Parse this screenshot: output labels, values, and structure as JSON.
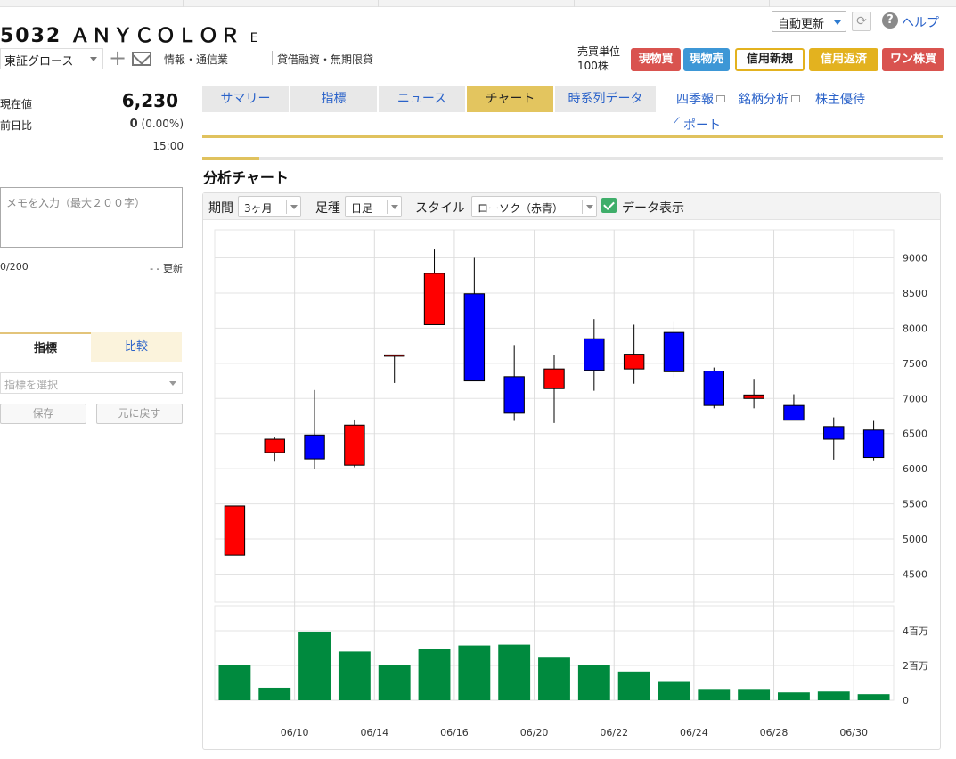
{
  "header": {
    "ticker_name": "5032 ＡＮＹＣＯＬＯＲ",
    "ticker_suffix": "E",
    "market": "東証グロース",
    "industry": "情報・通信業",
    "margin_type": "貸借融資・無期限貸",
    "auto_update": "自動更新",
    "help": "ヘルプ"
  },
  "trade": {
    "unit_label": "売買単位",
    "unit_value": "100株",
    "buttons": [
      "現物買",
      "現物売",
      "信用新規",
      "信用返済",
      "ワン株買"
    ]
  },
  "quote": {
    "price_label": "現在値",
    "price": "6,230",
    "change_label": "前日比",
    "change": "0",
    "change_pct": "(0.00%)",
    "time": "15:00"
  },
  "memo": {
    "placeholder": "メモを入力（最大２００字）",
    "count": "0/200",
    "updated": "- - 更新"
  },
  "indicator_panel": {
    "tabs": [
      "指標",
      "比較"
    ],
    "select_placeholder": "指標を選択",
    "save_label": "保存",
    "reset_label": "元に戻す"
  },
  "nav": {
    "tabs": [
      "サマリー",
      "指標",
      "ニュース",
      "チャート",
      "時系列データ"
    ],
    "active_tab": "チャート",
    "links": [
      "四季報",
      "銘柄分析",
      "株主優待"
    ],
    "report_link": "レポート"
  },
  "chart_panel": {
    "title": "分析チャート",
    "period_label": "期間",
    "period_value": "3ヶ月",
    "interval_label": "足種",
    "interval_value": "日足",
    "style_label": "スタイル",
    "style_value": "ローソク（赤青）",
    "data_display_label": "データ表示",
    "data_display_checked": true
  },
  "chart_data": {
    "type": "candlestick",
    "up_color": "#ff0000",
    "down_color": "#0000ff",
    "volume_color": "#008a3e",
    "price_axis": {
      "ticks": [
        4500,
        5000,
        5500,
        6000,
        6500,
        7000,
        7500,
        8000,
        8500,
        9000
      ],
      "range": [
        4100,
        9400
      ]
    },
    "volume_axis": {
      "tick_labels": [
        "0",
        "2百万",
        "4百万"
      ],
      "tick_values": [
        0,
        2000000,
        4000000
      ],
      "max": 4000000
    },
    "x_labels": [
      "06/10",
      "06/14",
      "06/16",
      "06/20",
      "06/22",
      "06/24",
      "06/28",
      "06/30"
    ],
    "x_label_days": [
      2,
      4,
      6,
      8,
      10,
      12,
      14,
      16
    ],
    "candles": [
      {
        "day": 1,
        "open": 4770,
        "high": 5470,
        "low": 4770,
        "close": 5470,
        "volume": 2050000
      },
      {
        "day": 2,
        "open": 6230,
        "high": 6450,
        "low": 6100,
        "close": 6420,
        "volume": 720000
      },
      {
        "day": 3,
        "open": 6480,
        "high": 7120,
        "low": 5990,
        "close": 6140,
        "volume": 3950000
      },
      {
        "day": 4,
        "open": 6050,
        "high": 6700,
        "low": 6020,
        "close": 6620,
        "volume": 2800000
      },
      {
        "day": 5,
        "open": 7620,
        "high": 7620,
        "low": 7220,
        "close": 7620,
        "volume": 2050000
      },
      {
        "day": 6,
        "open": 8050,
        "high": 9120,
        "low": 8050,
        "close": 8780,
        "volume": 2950000
      },
      {
        "day": 7,
        "open": 8490,
        "high": 9000,
        "low": 7250,
        "close": 7250,
        "volume": 3150000
      },
      {
        "day": 8,
        "open": 7310,
        "high": 7760,
        "low": 6680,
        "close": 6790,
        "volume": 3200000
      },
      {
        "day": 9,
        "open": 7140,
        "high": 7620,
        "low": 6650,
        "close": 7420,
        "volume": 2450000
      },
      {
        "day": 10,
        "open": 7850,
        "high": 8130,
        "low": 7110,
        "close": 7400,
        "volume": 2050000
      },
      {
        "day": 11,
        "open": 7420,
        "high": 8050,
        "low": 7210,
        "close": 7630,
        "volume": 1650000
      },
      {
        "day": 12,
        "open": 7940,
        "high": 8100,
        "low": 7300,
        "close": 7380,
        "volume": 1050000
      },
      {
        "day": 13,
        "open": 7390,
        "high": 7440,
        "low": 6860,
        "close": 6900,
        "volume": 650000
      },
      {
        "day": 14,
        "open": 7000,
        "high": 7280,
        "low": 6860,
        "close": 7050,
        "volume": 650000
      },
      {
        "day": 15,
        "open": 6900,
        "high": 7060,
        "low": 6700,
        "close": 6690,
        "volume": 450000
      },
      {
        "day": 16,
        "open": 6600,
        "high": 6730,
        "low": 6130,
        "close": 6420,
        "volume": 500000
      },
      {
        "day": 17,
        "open": 6550,
        "high": 6680,
        "low": 6120,
        "close": 6160,
        "volume": 350000
      }
    ]
  }
}
